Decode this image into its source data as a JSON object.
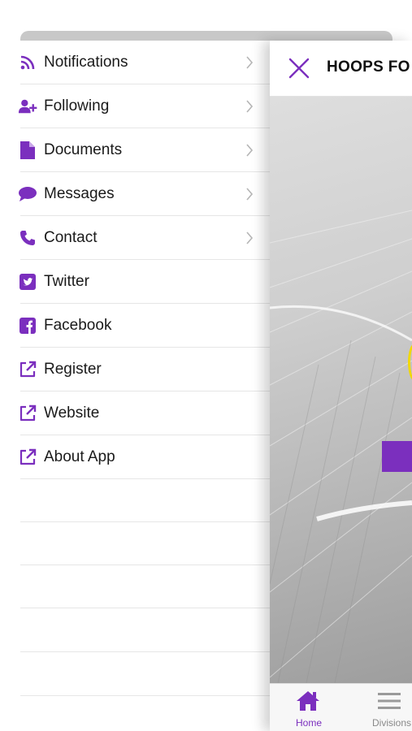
{
  "accent_color": "#7b2fbe",
  "menu": {
    "items": [
      {
        "label": "Notifications",
        "icon": "rss-icon",
        "has_chevron": true
      },
      {
        "label": "Following",
        "icon": "user-plus-icon",
        "has_chevron": true
      },
      {
        "label": "Documents",
        "icon": "document-icon",
        "has_chevron": true
      },
      {
        "label": "Messages",
        "icon": "chat-bubble-icon",
        "has_chevron": true
      },
      {
        "label": "Contact",
        "icon": "phone-icon",
        "has_chevron": true
      },
      {
        "label": "Twitter",
        "icon": "twitter-icon",
        "has_chevron": false
      },
      {
        "label": "Facebook",
        "icon": "facebook-icon",
        "has_chevron": false
      },
      {
        "label": "Register",
        "icon": "external-link-icon",
        "has_chevron": false
      },
      {
        "label": "Website",
        "icon": "external-link-icon",
        "has_chevron": false
      },
      {
        "label": "About App",
        "icon": "external-link-icon",
        "has_chevron": false
      }
    ]
  },
  "panel": {
    "title": "HOOPS FO",
    "close_icon": "close-icon"
  },
  "bottom_nav": {
    "tabs": [
      {
        "label": "Home",
        "icon": "home-icon",
        "active": true
      },
      {
        "label": "Divisions",
        "icon": "menu-icon",
        "active": false
      }
    ]
  }
}
